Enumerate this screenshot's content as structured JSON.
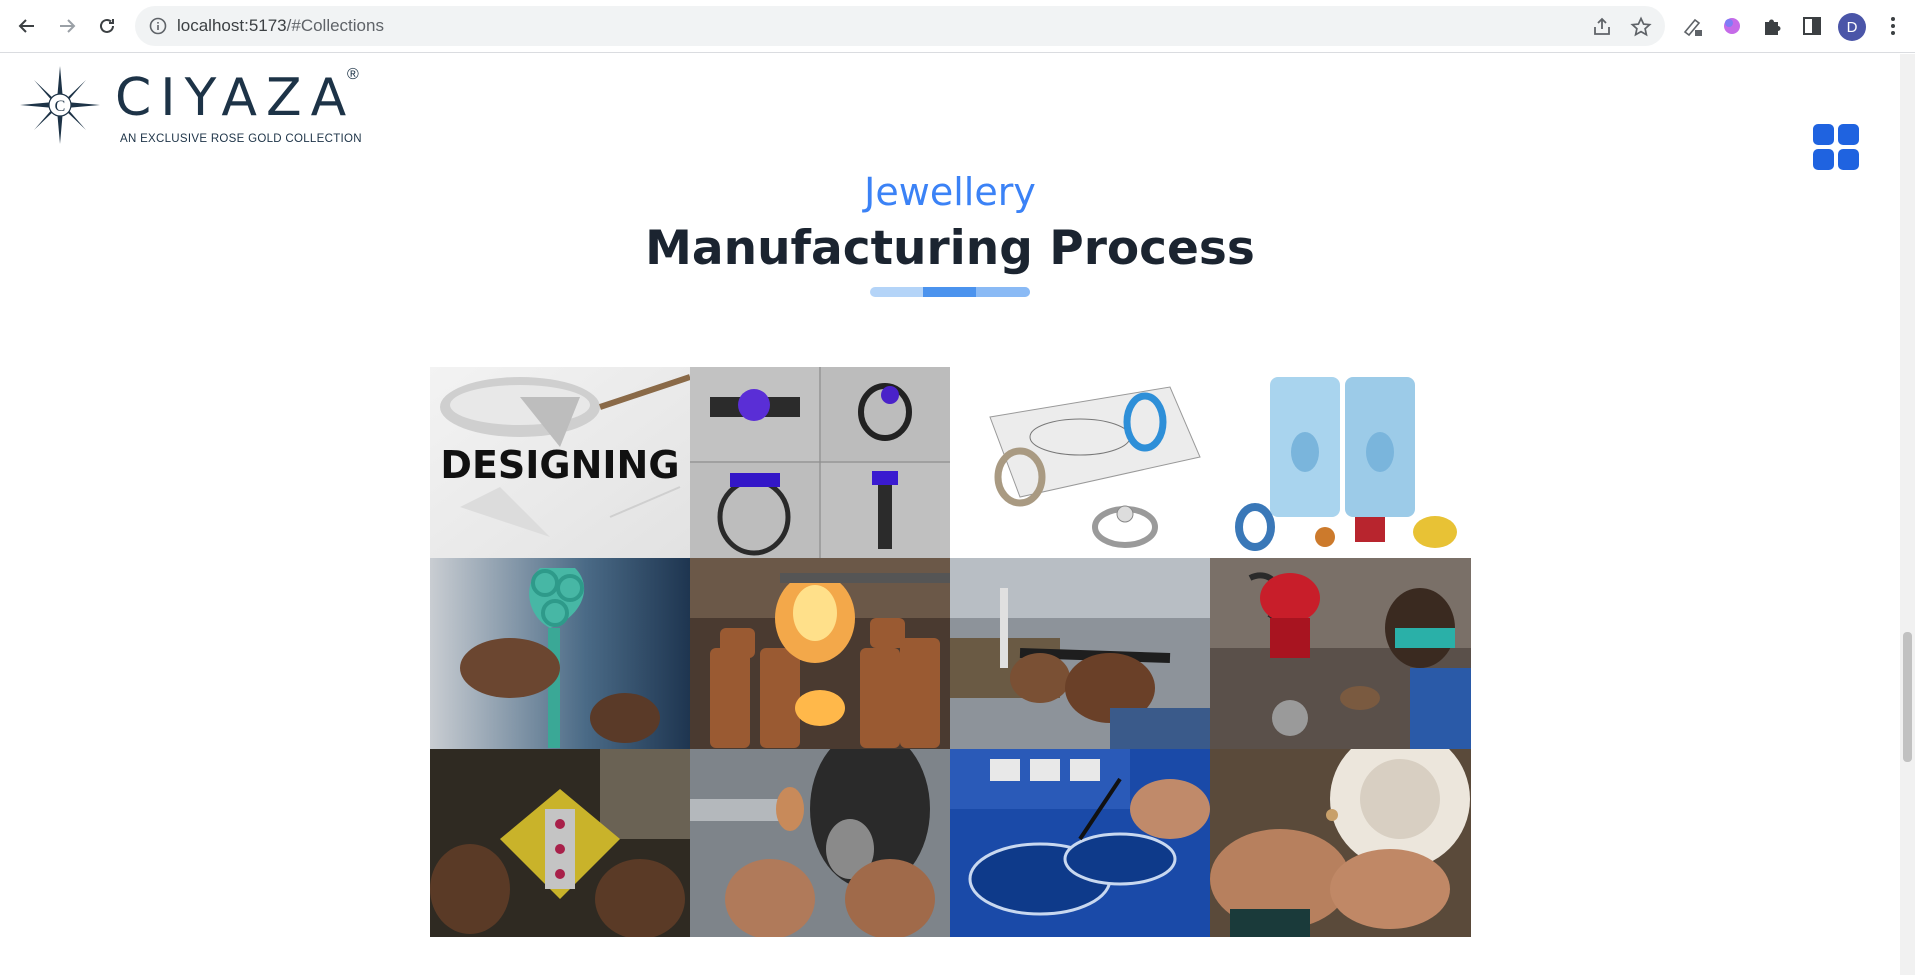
{
  "browser": {
    "url_host": "localhost:5173",
    "url_path": "/#Collections",
    "profile_initial": "D",
    "icons": [
      "back-icon",
      "forward-icon",
      "reload-icon",
      "info-icon",
      "share-icon",
      "star-icon",
      "extension-icon",
      "puzzle-icon",
      "sidepanel-icon",
      "more-icon"
    ]
  },
  "header": {
    "logo_word": "CIYAZA",
    "logo_registered": "®",
    "logo_tagline": "AN EXCLUSIVE ROSE GOLD COLLECTION",
    "menu_icon": "grid-menu-icon"
  },
  "section": {
    "subtitle": "Jewellery",
    "title": "Manufacturing Process",
    "accent_color": "#3b82f6",
    "title_color": "#1b2430"
  },
  "gallery": {
    "tiles": [
      {
        "label": "DESIGNING",
        "image": "bracelet-sketch"
      },
      {
        "label": "",
        "image": "cad-ring-views"
      },
      {
        "label": "",
        "image": "ring-model-sketch"
      },
      {
        "label": "",
        "image": "wax-mold"
      },
      {
        "label": "",
        "image": "wax-tree"
      },
      {
        "label": "",
        "image": "metal-casting"
      },
      {
        "label": "",
        "image": "filing-tool"
      },
      {
        "label": "",
        "image": "workshop-polishing"
      },
      {
        "label": "",
        "image": "stone-setting"
      },
      {
        "label": "",
        "image": "grinding-wheel"
      },
      {
        "label": "",
        "image": "electroplating"
      },
      {
        "label": "",
        "image": "buffing-wheel"
      }
    ]
  }
}
